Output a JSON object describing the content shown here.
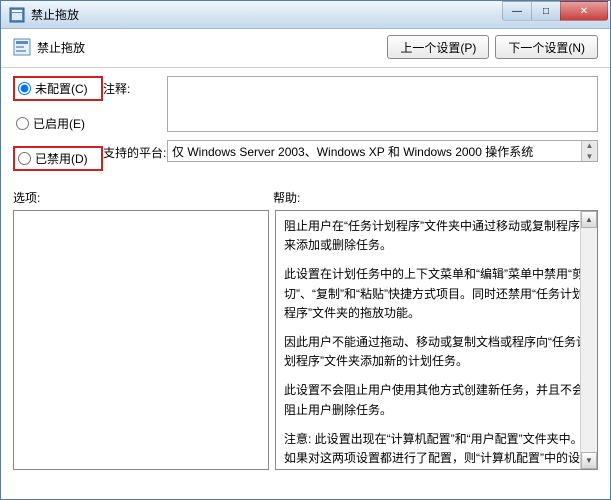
{
  "window": {
    "title": "禁止拖放"
  },
  "win_controls": {
    "min": "—",
    "max": "□",
    "close": "✕"
  },
  "header": {
    "section_title": "禁止拖放",
    "prev_btn": "上一个设置(P)",
    "next_btn": "下一个设置(N)"
  },
  "config": {
    "not_configured": {
      "label": "未配置(C)",
      "selected": true
    },
    "enabled": {
      "label": "已启用(E)",
      "selected": false
    },
    "disabled": {
      "label": "已禁用(D)",
      "selected": false
    }
  },
  "fields": {
    "comment_label": "注释:",
    "comment_value": "",
    "platform_label": "支持的平台:",
    "platform_value": "仅 Windows Server 2003、Windows XP 和 Windows 2000 操作系统"
  },
  "panels": {
    "options_label": "选项:",
    "help_label": "帮助:",
    "help_text": {
      "p1": "阻止用户在“任务计划程序”文件夹中通过移动或复制程序来添加或删除任务。",
      "p2": "此设置在计划任务中的上下文菜单和“编辑”菜单中禁用“剪切”、“复制”和“粘贴”快捷方式项目。同时还禁用“任务计划程序”文件夹的拖放功能。",
      "p3": "因此用户不能通过拖动、移动或复制文档或程序向“任务计划程序”文件夹添加新的计划任务。",
      "p4": "此设置不会阻止用户使用其他方式创建新任务，并且不会阻止用户删除任务。",
      "p5": "注意: 此设置出现在“计算机配置”和“用户配置”文件夹中。如果对这两项设置都进行了配置，则“计算机配置”中的设置优先于“用户配置”中"
    }
  }
}
